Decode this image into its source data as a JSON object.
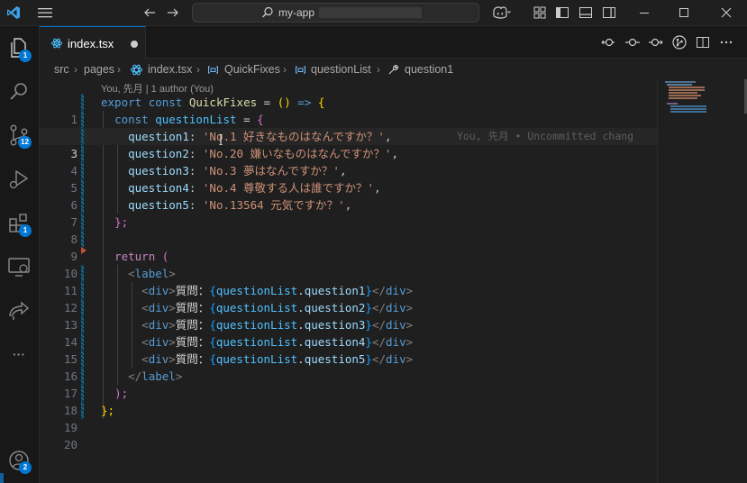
{
  "titlebar": {
    "search_text": "my-app",
    "colors": {
      "accent": "#0078d4",
      "background": "#1f1f1f"
    }
  },
  "activitybar": {
    "items": [
      {
        "name": "explorer",
        "icon": "files-icon",
        "badge": "1"
      },
      {
        "name": "search",
        "icon": "search-icon",
        "badge": ""
      },
      {
        "name": "source-control",
        "icon": "source-control-icon",
        "badge": "12"
      },
      {
        "name": "run-debug",
        "icon": "run-debug-icon",
        "badge": ""
      },
      {
        "name": "extensions",
        "icon": "extensions-icon",
        "badge": "1"
      },
      {
        "name": "remote-explorer",
        "icon": "remote-icon",
        "badge": ""
      },
      {
        "name": "live-share",
        "icon": "share-icon",
        "badge": ""
      },
      {
        "name": "more",
        "icon": "more-icon",
        "label": "···"
      }
    ],
    "account_badge": "2"
  },
  "tab": {
    "label": "index.tsx",
    "modified": true
  },
  "breadcrumb": [
    "src",
    "pages",
    "index.tsx",
    "QuickFixes",
    "questionList",
    "question1"
  ],
  "codelens": "You, 先月 | 1 author (You)",
  "blame": "You, 先月 • Uncommitted chang",
  "line_numbers": [
    "1",
    "2",
    "3",
    "4",
    "5",
    "6",
    "7",
    "8",
    "9",
    "10",
    "11",
    "12",
    "13",
    "14",
    "15",
    "16",
    "17",
    "18",
    "19",
    "20"
  ],
  "code": {
    "l1": {
      "k1": "export",
      "k2": "const",
      "name": "QuickFixes",
      "eq": " = ",
      "paren": "()",
      "arrow": " => ",
      "brace": "{"
    },
    "l2": {
      "k": "const",
      "name": "questionList",
      "eq": " = ",
      "brace": "{"
    },
    "props": [
      {
        "key": "question1",
        "value": "'No.1 好きなものはなんですか？'"
      },
      {
        "key": "question2",
        "value": "'No.20 嫌いなものはなんですか？'"
      },
      {
        "key": "question3",
        "value": "'No.3 夢はなんですか？'"
      },
      {
        "key": "question4",
        "value": "'No.4 尊敬する人は誰ですか？'"
      },
      {
        "key": "question5",
        "value": "'No.13564 元気ですか？'"
      }
    ],
    "l8": "};",
    "l10": {
      "k": "return",
      "paren": "("
    },
    "l11": {
      "tag": "label"
    },
    "divs": [
      {
        "label": "質問：",
        "obj": "questionList",
        "prop": "question1"
      },
      {
        "label": "質問：",
        "obj": "questionList",
        "prop": "question2"
      },
      {
        "label": "質問：",
        "obj": "questionList",
        "prop": "question3"
      },
      {
        "label": "質問：",
        "obj": "questionList",
        "prop": "question4"
      },
      {
        "label": "質問：",
        "obj": "questionList",
        "prop": "question5"
      }
    ],
    "div_tag": "div",
    "l17": {
      "tag": "label"
    },
    "l18": ");",
    "l19": "};"
  }
}
